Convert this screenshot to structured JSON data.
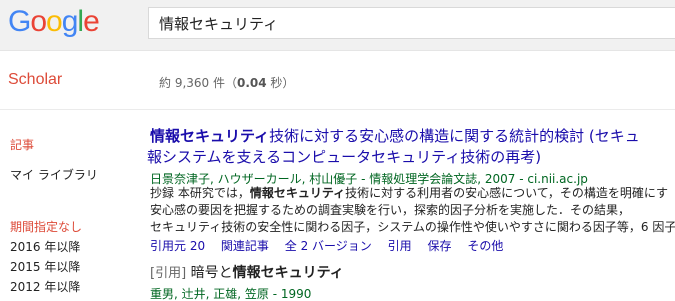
{
  "header": {
    "logo": [
      "G",
      "o",
      "o",
      "g",
      "l",
      "e"
    ],
    "logo_colors": [
      "#4285f4",
      "#ea4335",
      "#fbbc05",
      "#4285f4",
      "#34a853",
      "#ea4335"
    ],
    "search_value": "情報セキュリティ"
  },
  "subheader": {
    "section_label": "Scholar",
    "stats_prefix": "約 9,360 件（",
    "stats_time": "0.04",
    "stats_suffix": " 秒）"
  },
  "sidebar": {
    "articles": "記事",
    "my_library": "マイ ライブラリ",
    "period_any": "期間指定なし",
    "since_2016": "2016 年以降",
    "since_2015": "2015 年以降",
    "since_2012": "2012 年以降"
  },
  "results": [
    {
      "title_bold": "情報セキュリティ",
      "title_rest_line1": "技術に対する安心感の構造に関する統計的検討 (セキュ",
      "title_line2": "報システムを支えるコンピュータセキュリティ技術の再考)",
      "authors": "日景奈津子, ハウザーカール, 村山優子 - 情報処理学会論文誌, 2007 - ci.nii.ac.jp",
      "snippet1_pre": "抄録 本研究では，",
      "snippet1_bold": "情報セキュリティ",
      "snippet1_post": "技術に対する利用者の安心感について，その構造を明確にす",
      "snippet2": "安心感の要因を把握するための調査実験を行い，探索的因子分析を実施した．その結果，",
      "snippet3": "セキュリティ技術の安全性に関わる因子，システムの操作性や使いやすさに関わる因子等，6 因子",
      "links": {
        "cited": "引用元 20",
        "related": "関連記事",
        "versions": "全 2 バージョン",
        "cite": "引用",
        "save": "保存",
        "more": "その他"
      }
    },
    {
      "tag": "[引用]",
      "title_pre": "暗号と",
      "title_bold": "情報セキュリティ",
      "authors": "重男, 辻井, 正雄, 笠原 - 1990"
    }
  ]
}
